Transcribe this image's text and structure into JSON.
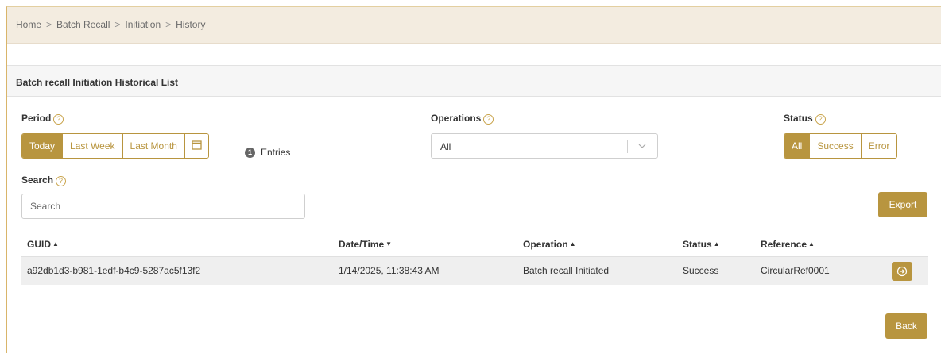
{
  "breadcrumb": [
    "Home",
    "Batch Recall",
    "Initiation",
    "History"
  ],
  "breadcrumb_separator": ">",
  "panel_title": "Batch recall Initiation Historical List",
  "help_glyph": "?",
  "period": {
    "label": "Period",
    "options": [
      "Today",
      "Last Week",
      "Last Month"
    ],
    "active": "Today"
  },
  "entries": {
    "count": "1",
    "label": "Entries"
  },
  "operations": {
    "label": "Operations",
    "selected": "All"
  },
  "status_filter": {
    "label": "Status",
    "options": [
      "All",
      "Success",
      "Error"
    ],
    "active": "All"
  },
  "search": {
    "label": "Search",
    "placeholder": "Search"
  },
  "export_label": "Export",
  "table": {
    "columns": [
      {
        "label": "GUID",
        "sort": "asc"
      },
      {
        "label": "Date/Time",
        "sort": "desc"
      },
      {
        "label": "Operation",
        "sort": "asc"
      },
      {
        "label": "Status",
        "sort": "asc"
      },
      {
        "label": "Reference",
        "sort": "asc"
      }
    ],
    "rows": [
      [
        "a92db1d3-b981-1edf-b4c9-5287ac5f13f2",
        "1/14/2025, 11:38:43 AM",
        "Batch recall Initiated",
        "Success",
        "CircularRef0001"
      ]
    ]
  },
  "back_label": "Back",
  "colors": {
    "accent": "#b8953f",
    "breadcrumb_bg": "#f3ece0",
    "row_bg": "#efefef"
  }
}
